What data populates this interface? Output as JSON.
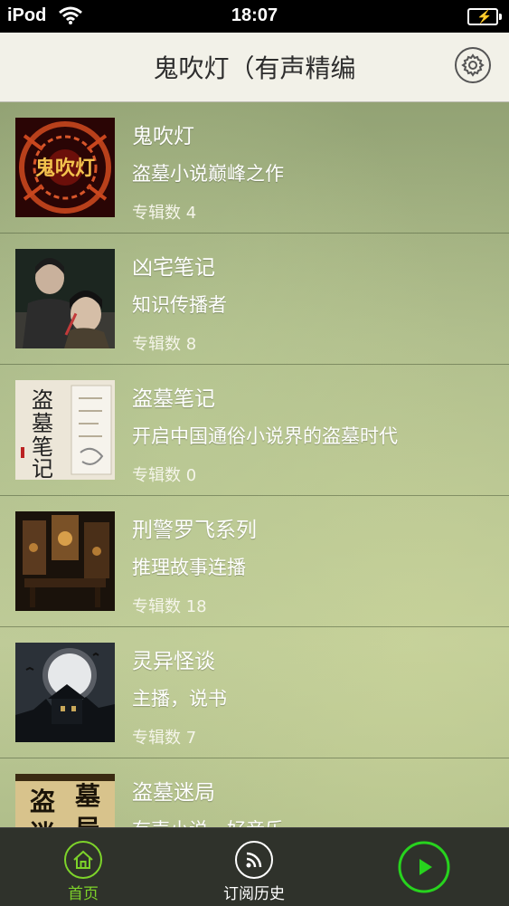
{
  "status": {
    "carrier": "iPod",
    "time": "18:07"
  },
  "nav": {
    "title": "鬼吹灯（有声精编"
  },
  "items": [
    {
      "title": "鬼吹灯",
      "desc": "盗墓小说巅峰之作",
      "count": "专辑数 4"
    },
    {
      "title": "凶宅笔记",
      "desc": "知识传播者",
      "count": "专辑数 8"
    },
    {
      "title": "盗墓笔记",
      "desc": "开启中国通俗小说界的盗墓时代",
      "count": "专辑数 0"
    },
    {
      "title": "刑警罗飞系列",
      "desc": "推理故事连播",
      "count": "专辑数 18"
    },
    {
      "title": "灵异怪谈",
      "desc": "主播，说书",
      "count": "专辑数 7"
    },
    {
      "title": "盗墓迷局",
      "desc": "有声小说，好音乐",
      "count": ""
    }
  ],
  "thumb_text": {
    "guichuideng": "鬼吹灯",
    "daomu_1": "盗",
    "daomu_2": "墓",
    "daomu_3": "笔",
    "daomu_4": "记",
    "mi_1": "盗",
    "mi_2": "墓",
    "mi_3": "迷",
    "mi_4": "局"
  },
  "tabs": {
    "home": "首页",
    "history": "订阅历史"
  },
  "colors": {
    "accent": "#7dd32a",
    "tab_bg": "#2f322b",
    "nav_bg": "#f2f1e8"
  }
}
